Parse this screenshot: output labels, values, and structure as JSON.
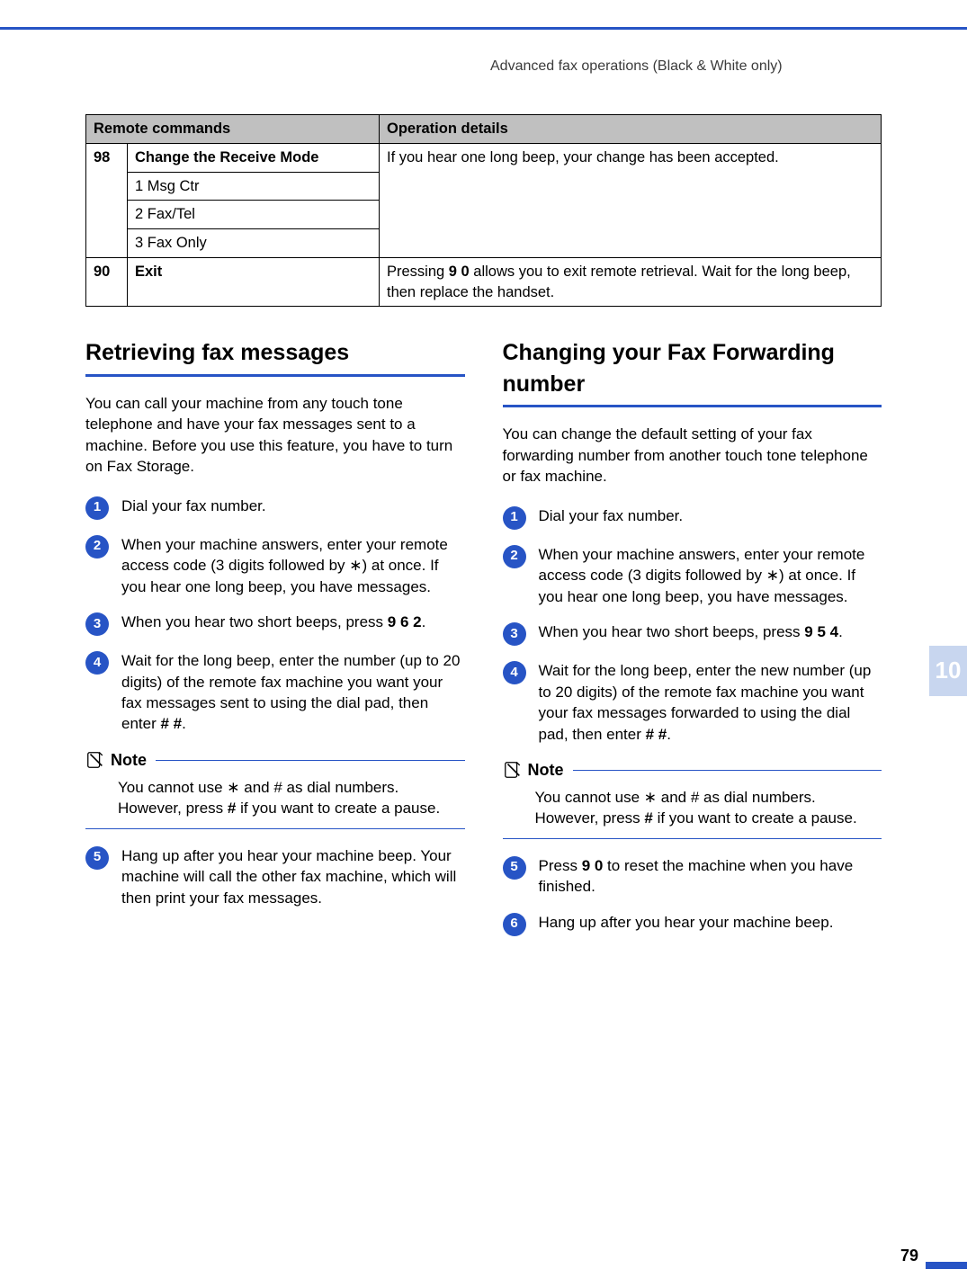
{
  "header": "Advanced fax operations (Black & White only)",
  "table": {
    "head": {
      "col1": "Remote commands",
      "col2": "Operation details"
    },
    "row98": {
      "code": "98",
      "title": "Change the Receive Mode",
      "opts": [
        "1 Msg Ctr",
        "2 Fax/Tel",
        "3 Fax Only"
      ],
      "detail": "If you hear one long beep, your change has been accepted."
    },
    "row90": {
      "code": "90",
      "title": "Exit",
      "detail_pre": "Pressing ",
      "detail_bold": "9 0",
      "detail_post": " allows you to exit remote retrieval. Wait for the long beep, then replace the handset."
    }
  },
  "left": {
    "title": "Retrieving fax messages",
    "intro": "You can call your machine from any touch tone telephone and have your fax messages sent to a machine. Before you use this feature, you have to turn on Fax Storage.",
    "steps": {
      "1": "Dial your fax number.",
      "2": "When your machine answers, enter your remote access code (3 digits followed by ∗) at once. If you hear one long beep, you have messages.",
      "3_pre": "When you hear two short beeps, press ",
      "3_bold": "9 6 2",
      "3_post": ".",
      "4_pre": "Wait for the long beep, enter the number (up to 20 digits) of the remote fax machine you want your fax messages sent to using the dial pad, then enter ",
      "4_bold": "# #",
      "4_post": ".",
      "5": "Hang up after you hear your machine beep. Your machine will call the other fax machine, which will then print your fax messages."
    },
    "note_label": "Note",
    "note_pre": "You cannot use ∗ and # as dial numbers. However, press ",
    "note_bold": "#",
    "note_post": " if you want to create a pause."
  },
  "right": {
    "title": "Changing your Fax Forwarding number",
    "intro": "You can change the default setting of your fax forwarding number from another touch tone telephone or fax machine.",
    "steps": {
      "1": "Dial your fax number.",
      "2": "When your machine answers, enter your remote access code (3 digits followed by ∗) at once. If you hear one long beep, you have messages.",
      "3_pre": "When you hear two short beeps, press ",
      "3_bold": "9 5 4",
      "3_post": ".",
      "4_pre": "Wait for the long beep, enter the new number (up to 20 digits) of the remote fax machine you want your fax messages forwarded to using the dial pad, then enter ",
      "4_bold": "# #",
      "4_post": ".",
      "5_pre": "Press ",
      "5_bold": "9 0",
      "5_post": " to reset the machine when you have finished.",
      "6": "Hang up after you hear your machine beep."
    },
    "note_label": "Note",
    "note_pre": "You cannot use ∗ and # as dial numbers. However, press ",
    "note_bold": "#",
    "note_post": " if you want to create a pause."
  },
  "side_tab": "10",
  "page_num": "79"
}
